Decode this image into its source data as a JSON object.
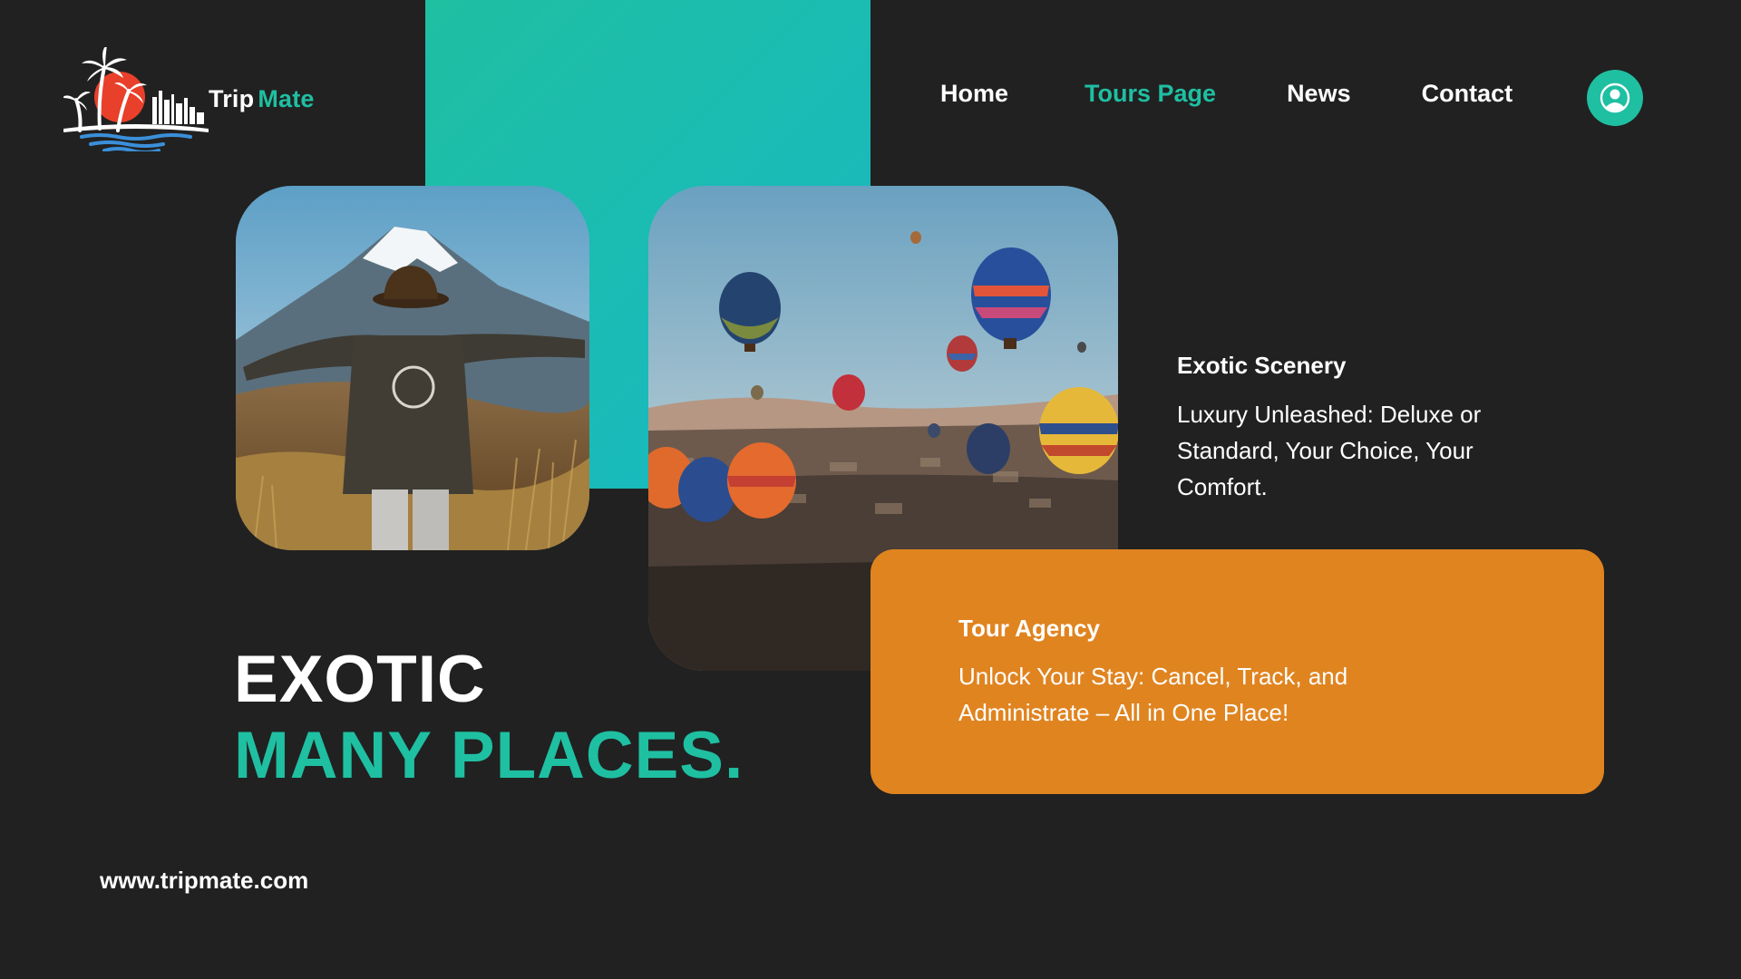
{
  "brand": {
    "name_part1": "Trip",
    "name_part2": "Mate"
  },
  "nav": {
    "items": [
      {
        "label": "Home"
      },
      {
        "label": "Tours Page",
        "active": true
      },
      {
        "label": "News"
      },
      {
        "label": "Contact"
      }
    ],
    "profile_icon": "user-circle-icon"
  },
  "colors": {
    "accent": "#1fbfa2",
    "orange": "#e08420",
    "background": "#212121"
  },
  "images": [
    {
      "name": "hiker-mountain-photo"
    },
    {
      "name": "hot-air-balloons-photo"
    }
  ],
  "features": {
    "scenery": {
      "title": "Exotic Scenery",
      "text": "Luxury Unleashed: Deluxe or Standard, Your Choice, Your Comfort."
    },
    "agency": {
      "title": "Tour Agency",
      "text": "Unlock Your Stay: Cancel, Track, and Administrate – All in One Place!"
    }
  },
  "hero": {
    "line1": "EXOTIC",
    "line2": "MANY PLACES."
  },
  "footer": {
    "website": "www.tripmate.com"
  }
}
